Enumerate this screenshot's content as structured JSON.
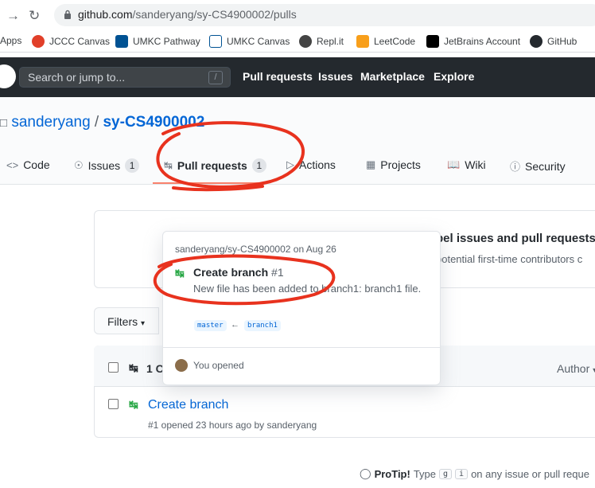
{
  "browser": {
    "url_host": "github.com",
    "url_path": "/sanderyang/sy-CS4900002/pulls",
    "bookmarks": [
      {
        "label": "Apps",
        "icon": "apps-grid-icon"
      },
      {
        "label": "JCCC Canvas",
        "icon": "canvas-icon",
        "color": "#e13f29"
      },
      {
        "label": "UMKC Pathway",
        "icon": "pathway-icon",
        "color": "#005293"
      },
      {
        "label": "UMKC Canvas",
        "icon": "umkc-icon",
        "color": "#005293"
      },
      {
        "label": "Repl.it",
        "icon": "replit-icon",
        "color": "#444444"
      },
      {
        "label": "LeetCode",
        "icon": "leetcode-icon",
        "color": "#f89f1b"
      },
      {
        "label": "JetBrains Account",
        "icon": "jetbrains-icon",
        "color": "#000000"
      },
      {
        "label": "GitHub",
        "icon": "github-icon",
        "color": "#24292e"
      }
    ]
  },
  "header": {
    "search_placeholder": "Search or jump to...",
    "search_key": "/",
    "nav": [
      "Pull requests",
      "Issues",
      "Marketplace",
      "Explore"
    ]
  },
  "repo": {
    "owner": "sanderyang",
    "separator": "/",
    "name": "sy-CS4900002",
    "tabs": [
      {
        "label": "Code",
        "icon": "code-icon"
      },
      {
        "label": "Issues",
        "icon": "issue-icon",
        "count": "1"
      },
      {
        "label": "Pull requests",
        "icon": "pull-request-icon",
        "count": "1"
      },
      {
        "label": "Actions",
        "icon": "play-icon"
      },
      {
        "label": "Projects",
        "icon": "project-icon"
      },
      {
        "label": "Wiki",
        "icon": "book-icon"
      },
      {
        "label": "Security",
        "icon": "shield-icon"
      }
    ]
  },
  "banner": {
    "title": "bel issues and pull requests f",
    "subtitle": "potential first-time contributors c"
  },
  "list": {
    "filters_label": "Filters",
    "header_count": "1 C",
    "author_filter": "Author",
    "pr_title": "Create branch",
    "pr_meta": "#1 opened 23 hours ago by sanderyang"
  },
  "hovercard": {
    "repo_line": "sanderyang/sy-CS4900002 on Aug 26",
    "title": "Create branch",
    "number": "#1",
    "body": "New file has been added to branch1: branch1 file.",
    "base_branch": "master",
    "head_branch": "branch1",
    "footer": "You opened"
  },
  "protip": {
    "label": "ProTip!",
    "text_before": "Type",
    "key1": "g",
    "key2": "i",
    "text_after": "on any issue or pull reque"
  },
  "annotation_color": "#e8321e"
}
